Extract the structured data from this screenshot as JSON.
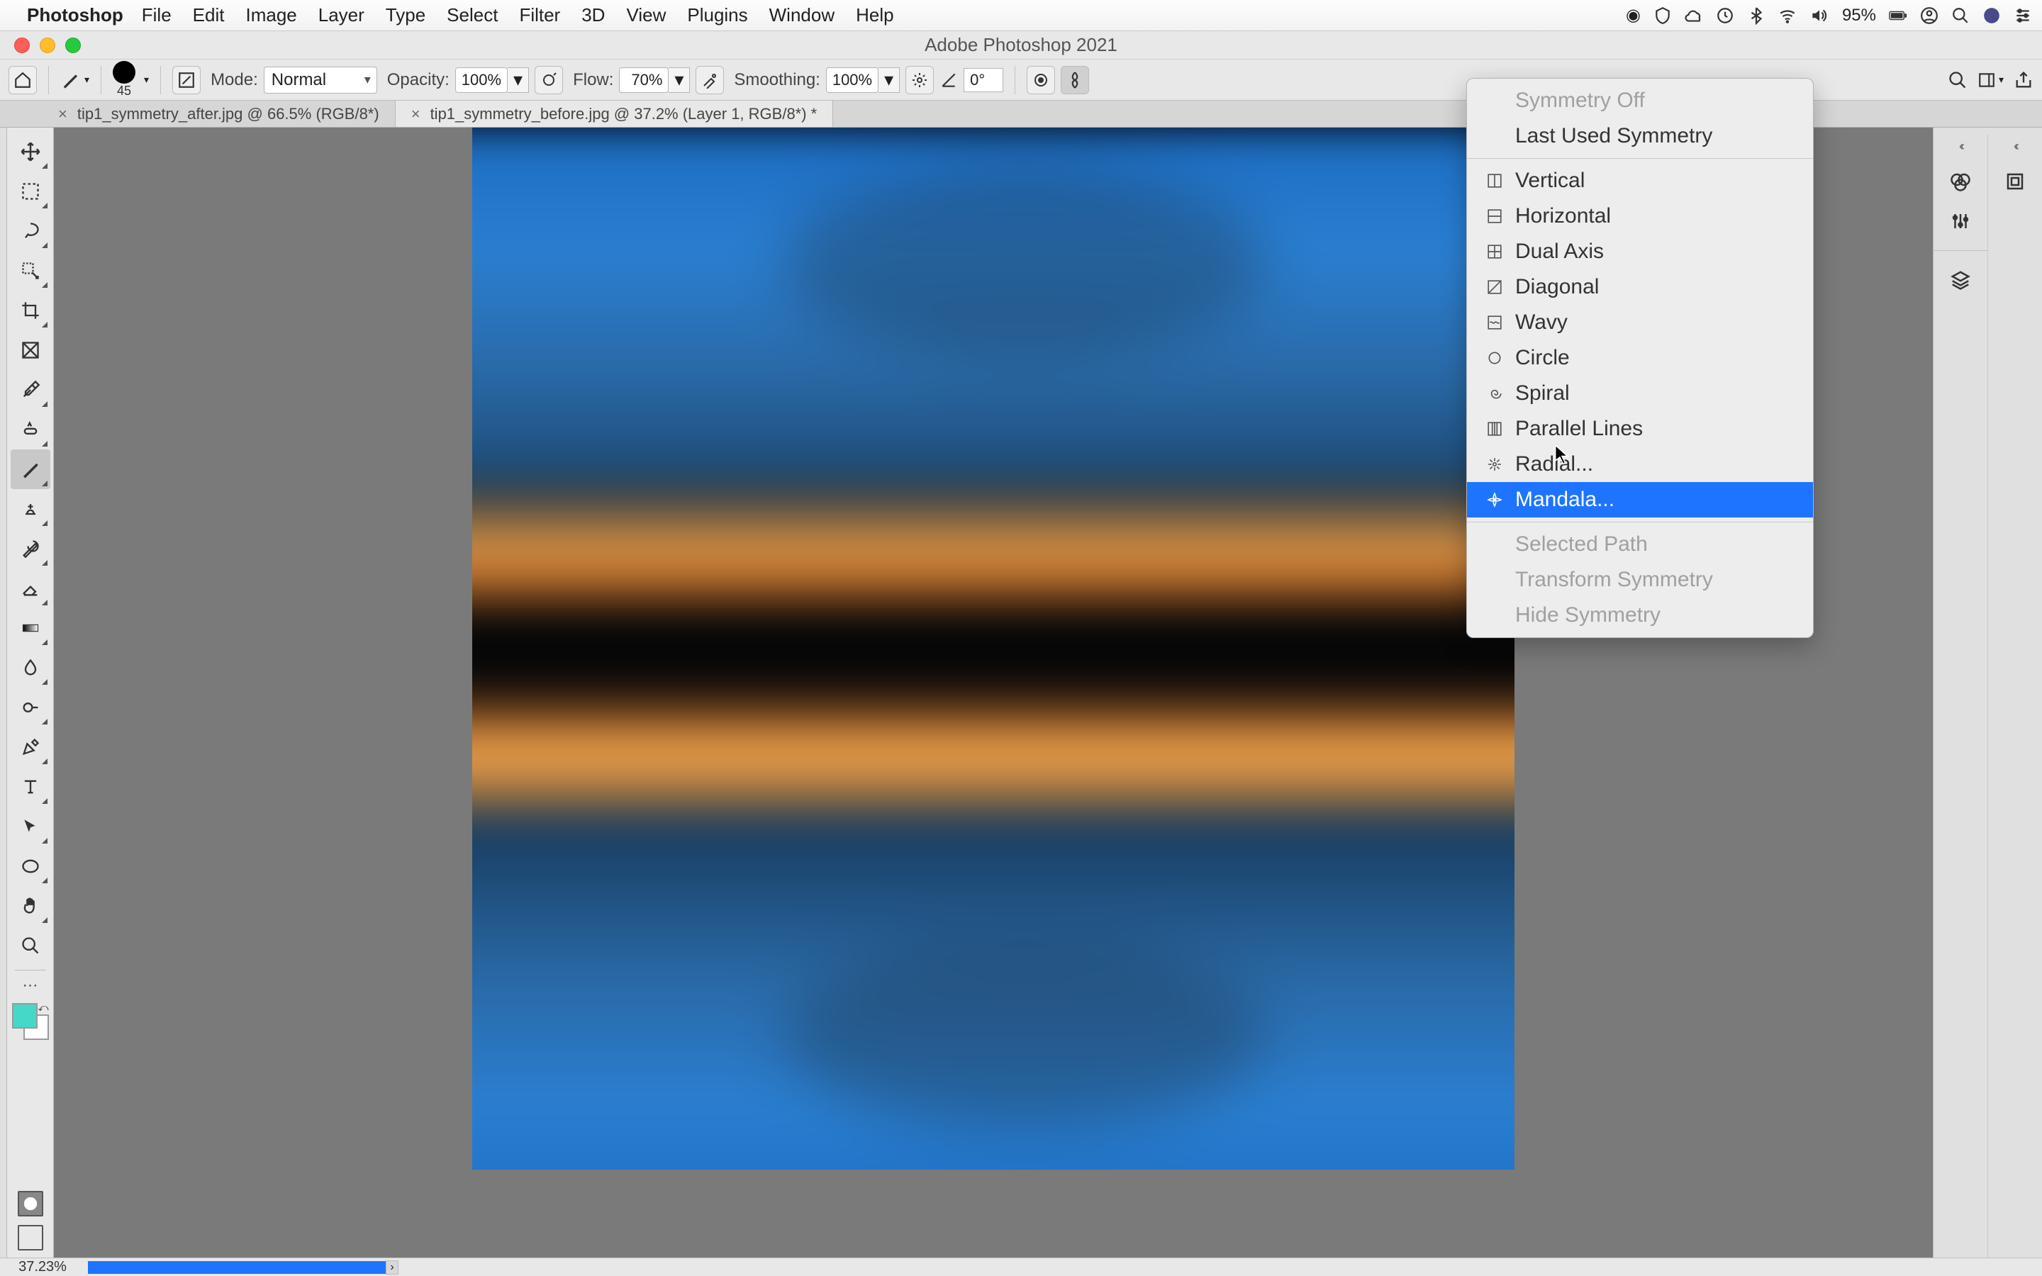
{
  "menubar": {
    "appname": "Photoshop",
    "items": [
      "File",
      "Edit",
      "Image",
      "Layer",
      "Type",
      "Select",
      "Filter",
      "3D",
      "View",
      "Plugins",
      "Window",
      "Help"
    ],
    "battery_pct": "95%"
  },
  "window": {
    "title": "Adobe Photoshop 2021"
  },
  "options": {
    "brush_size": "45",
    "mode_label": "Mode:",
    "mode_value": "Normal",
    "opacity_label": "Opacity:",
    "opacity_value": "100%",
    "flow_label": "Flow:",
    "flow_value": "70%",
    "smoothing_label": "Smoothing:",
    "smoothing_value": "100%",
    "angle_value": "0°"
  },
  "tabs": [
    {
      "label": "tip1_symmetry_after.jpg @ 66.5% (RGB/8*)",
      "active": false
    },
    {
      "label": "tip1_symmetry_before.jpg @ 37.2% (Layer 1, RGB/8*) *",
      "active": true
    }
  ],
  "swatches": {
    "fg": "#45d8c9",
    "bg": "#ffffff"
  },
  "symmetry_menu": {
    "header": [
      {
        "label": "Symmetry Off",
        "disabled": true
      },
      {
        "label": "Last Used Symmetry",
        "disabled": false
      }
    ],
    "items": [
      {
        "label": "Vertical",
        "icon": "vertical"
      },
      {
        "label": "Horizontal",
        "icon": "horizontal"
      },
      {
        "label": "Dual Axis",
        "icon": "dual"
      },
      {
        "label": "Diagonal",
        "icon": "diagonal"
      },
      {
        "label": "Wavy",
        "icon": "wavy"
      },
      {
        "label": "Circle",
        "icon": "circle"
      },
      {
        "label": "Spiral",
        "icon": "spiral"
      },
      {
        "label": "Parallel Lines",
        "icon": "parallel"
      },
      {
        "label": "Radial...",
        "icon": "radial"
      },
      {
        "label": "Mandala...",
        "icon": "mandala",
        "highlight": true
      }
    ],
    "footer": [
      {
        "label": "Selected Path",
        "disabled": true
      },
      {
        "label": "Transform Symmetry",
        "disabled": true
      },
      {
        "label": "Hide Symmetry",
        "disabled": true
      }
    ]
  },
  "status": {
    "zoom": "37.23%"
  }
}
